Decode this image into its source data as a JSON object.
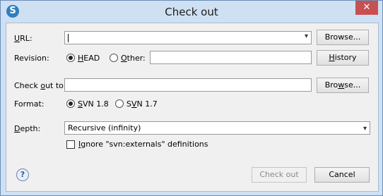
{
  "window": {
    "title": "Check out",
    "close_glyph": "✕",
    "app_icon_glyph": "S"
  },
  "url": {
    "label_u": "U",
    "label_rest": "RL:",
    "value": "",
    "browse": "Browse..."
  },
  "revision": {
    "label": "Revision:",
    "head_u": "H",
    "head_rest": "EAD",
    "other_u": "O",
    "other_rest": "ther:",
    "other_value": "",
    "history_u": "H",
    "history_rest": "istory",
    "selected": "HEAD"
  },
  "checkout_to": {
    "label_pre": "Check ",
    "label_u": "o",
    "label_post": "ut to:",
    "value": "",
    "browse_pre": "Bro",
    "browse_u": "w",
    "browse_post": "se..."
  },
  "format": {
    "label": "Format:",
    "svn18_u": "S",
    "svn18_rest": "VN 1.8",
    "svn17_pre": "S",
    "svn17_u": "V",
    "svn17_post": "N 1.7",
    "selected": "SVN 1.8"
  },
  "depth": {
    "label_u": "D",
    "label_rest": "epth:",
    "value": "Recursive (infinity)"
  },
  "externals": {
    "label_u": "I",
    "label_rest": "gnore \"svn:externals\" definitions",
    "checked": false
  },
  "footer": {
    "help_glyph": "?",
    "checkout_button": "Check out",
    "cancel_button": "Cancel"
  },
  "colors": {
    "title_bg": "#cfe0f3",
    "close_bg": "#c75050",
    "dialog_bg": "#f0f0f0"
  }
}
